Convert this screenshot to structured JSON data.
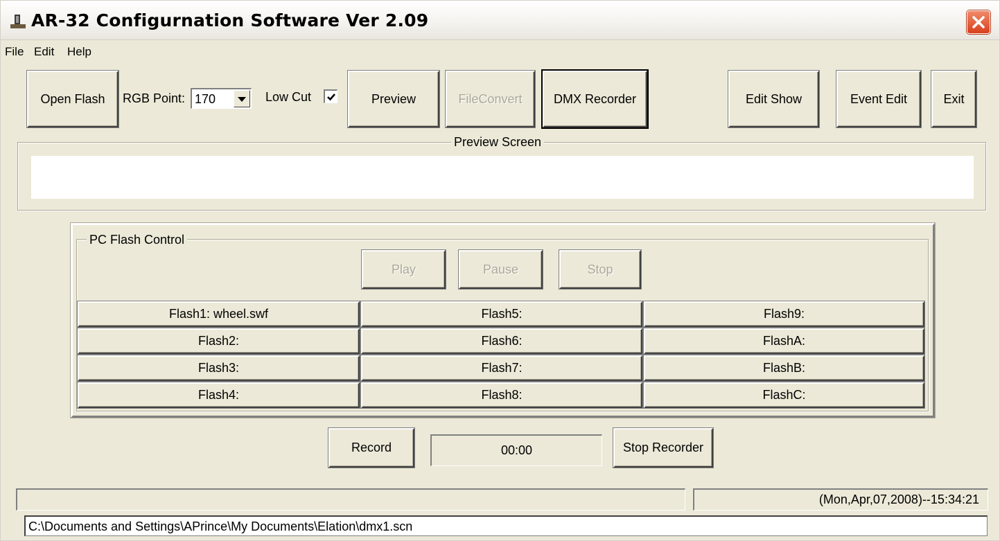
{
  "window": {
    "title": "AR-32 Configurnation Software Ver 2.09"
  },
  "menu": [
    "File",
    "Edit",
    "Help"
  ],
  "toolbar": {
    "open_flash": "Open Flash",
    "rgb_point_label": "RGB Point:",
    "rgb_point_value": "170",
    "low_cut_label": "Low Cut",
    "low_cut_checked": true,
    "preview": "Preview",
    "file_convert": "FileConvert",
    "dmx_recorder": "DMX Recorder",
    "edit_show": "Edit Show",
    "event_edit": "Event Edit",
    "exit": "Exit"
  },
  "preview_screen": {
    "title": "Preview Screen"
  },
  "flash_control": {
    "title": "PC Flash Control",
    "play": "Play",
    "pause": "Pause",
    "stop": "Stop",
    "col1": [
      "Flash1: wheel.swf",
      "Flash2:",
      "Flash3:",
      "Flash4:"
    ],
    "col2": [
      "Flash5:",
      "Flash6:",
      "Flash7:",
      "Flash8:"
    ],
    "col3": [
      "Flash9:",
      "FlashA:",
      "FlashB:",
      "FlashC:"
    ]
  },
  "recorder": {
    "record": "Record",
    "time": "00:00",
    "stop_recorder": "Stop Recorder"
  },
  "status": {
    "left": "",
    "datetime": "(Mon,Apr,07,2008)--15:34:21",
    "path": "C:\\Documents and Settings\\APrince\\My Documents\\Elation\\dmx1.scn"
  }
}
